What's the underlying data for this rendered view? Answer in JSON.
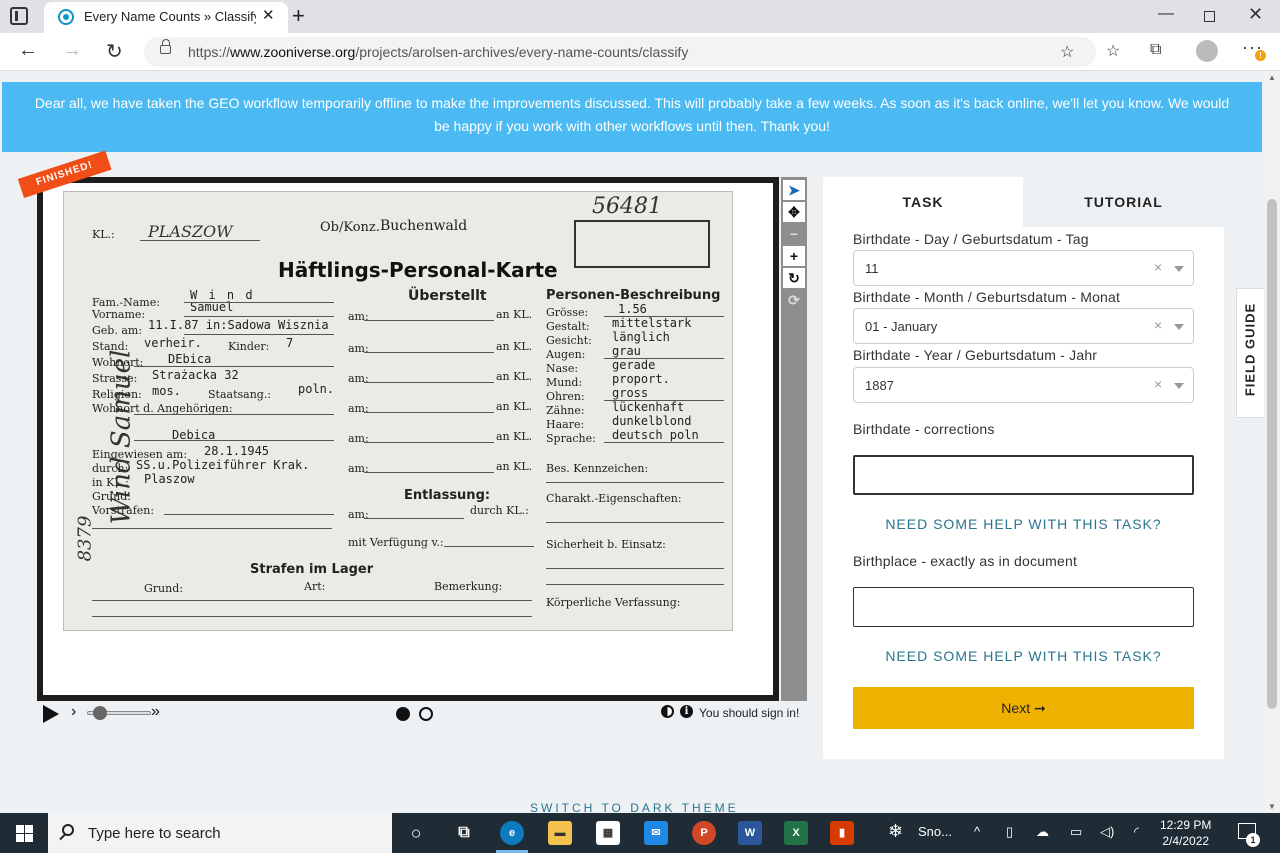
{
  "browser": {
    "tab_title": "Every Name Counts » Classify —",
    "url_prefix": "https://",
    "url_host": "www.zooniverse.org",
    "url_path": "/projects/arolsen-archives/every-name-counts/classify"
  },
  "banner": {
    "text": "Dear all, we have taken the GEO workflow temporarily offline to make the improvements discussed. This will probably take a few weeks. As soon as it's back online, we'll let you know. We would be happy if you work with other workflows until then. Thank you!"
  },
  "subject": {
    "status_ribbon": "FINISHED!",
    "card": {
      "number": "56481",
      "camp_header": "Buchenwald",
      "camp_header_prefix": "Ob/Konz.",
      "camp_label": "KL.:",
      "camp_value": "PLASZOW",
      "title": "Häftlings-Personal-Karte",
      "label_fam_name": "Fam.-Name:",
      "value_fam_name": "W i n d",
      "label_vorname": "Vorname:",
      "value_vorname": "Samuel",
      "label_geb": "Geb. am:",
      "value_geb": "11.I.87 in:Sadowa Wisznia",
      "label_stand": "Stand:",
      "value_stand": "verheir.",
      "label_kinder": "Kinder:",
      "value_kinder": "7",
      "label_wohnort": "Wohnort:",
      "value_wohnort": "DEbica",
      "label_strasse": "Strasse:",
      "value_strasse": "Strażacka 32",
      "label_religion": "Religion:",
      "value_religion": "mos.",
      "label_staatsang": "Staatsang.:",
      "value_staatsang": "poln.",
      "label_angehoerige": "Wohnort d. Angehörigen:",
      "value_angehoerige": "Debica",
      "label_eingewiesen": "Eingewiesen am:",
      "value_eingewiesen": "28.1.1945",
      "label_durch": "durch:",
      "value_durch": "SS.u.Polizeiführer Krak.",
      "label_inkl": "in KL.:",
      "value_inkl": "Plaszow",
      "label_grund": "Grund:",
      "label_vorstrafen": "Vorstrafen:",
      "section_ueberstellt": "Überstellt",
      "section_entlassung": "Entlassung:",
      "label_durch_kl": "durch KL.:",
      "label_verfuegung": "mit Verfügung v.:",
      "section_strafen": "Strafen im Lager",
      "label_strafen_grund": "Grund:",
      "label_strafen_art": "Art:",
      "label_strafen_bemerkung": "Bemerkung:",
      "section_beschreibung": "Personen-Beschreibung",
      "label_groesse": "Grösse:",
      "value_groesse": "1.56",
      "label_gestalt": "Gestalt:",
      "value_gestalt": "mittelstark",
      "label_gesicht": "Gesicht:",
      "value_gesicht": "länglich",
      "label_augen": "Augen:",
      "value_augen": "grau",
      "label_nase": "Nase:",
      "value_nase": "gerade",
      "label_mund": "Mund:",
      "value_mund": "proport.",
      "label_ohren": "Ohren:",
      "value_ohren": "gross",
      "label_zaehne": "Zähne:",
      "value_zaehne": "lückenhaft",
      "label_haare": "Haare:",
      "value_haare": "dunkelblond",
      "label_sprache": "Sprache:",
      "value_sprache": "deutsch poln",
      "label_kennzeichen": "Bes. Kennzeichen:",
      "label_charakt": "Charakt.-Eigenschaften:",
      "label_sicherheit": "Sicherheit b. Einsatz:",
      "label_koerper": "Körperliche Verfassung:",
      "label_am": "am:",
      "label_an_kl": "an KL.",
      "side_handwriting": "Wind Samuel",
      "side_number": "8379"
    },
    "signin_text": "You should sign in!"
  },
  "task_panel": {
    "tab_task": "TASK",
    "tab_tutorial": "TUTORIAL",
    "day_label": "Birthdate - Day / Geburtsdatum - Tag",
    "day_value": "11",
    "month_label": "Birthdate - Month / Geburtsdatum - Monat",
    "month_value": "01 - January",
    "year_label": "Birthdate - Year / Geburtsdatum - Jahr",
    "year_value": "1887",
    "corrections_label": "Birthdate - corrections",
    "help_link": "NEED SOME HELP WITH THIS TASK?",
    "birthplace_label": "Birthplace - exactly as in document",
    "next_label": "Next ➞"
  },
  "field_guide": "FIELD GUIDE",
  "dark_theme": "SWITCH TO DARK THEME",
  "taskbar": {
    "search_placeholder": "Type here to search",
    "weather_label": "Sno...",
    "time": "12:29 PM",
    "date": "2/4/2022",
    "notification_count": "1"
  },
  "colors": {
    "banner": "#4bbaf3",
    "next_button": "#f0b200",
    "link": "#2b7590",
    "ribbon": "#f04e16"
  }
}
